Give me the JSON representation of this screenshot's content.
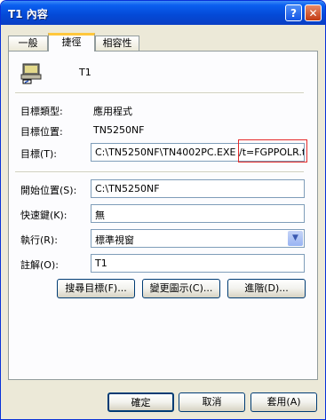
{
  "window": {
    "title": "T1 內容",
    "help_glyph": "?",
    "close_glyph": "✕"
  },
  "tabs": [
    {
      "label": "一般"
    },
    {
      "label": "捷徑",
      "active": true
    },
    {
      "label": "相容性"
    }
  ],
  "shortcut": {
    "name": "T1",
    "target_type_label": "目標類型:",
    "target_type_value": "應用程式",
    "target_location_label": "目標位置:",
    "target_location_value": "TN5250NF",
    "target_label": "目標(T):",
    "target_value_main": "C:\\TN5250NF\\TN4002PC.EXE /t=",
    "target_value_highlighted": "FGPPOLR.tto",
    "start_in_label": "開始位置(S):",
    "start_in_value": "C:\\TN5250NF",
    "shortcut_key_label": "快速鍵(K):",
    "shortcut_key_value": "無",
    "run_label": "執行(R):",
    "run_value": "標準視窗",
    "comment_label": "註解(O):",
    "comment_value": "T1"
  },
  "panel_buttons": {
    "find_target": "搜尋目標(F)...",
    "change_icon": "變更圖示(C)...",
    "advanced": "進階(D)..."
  },
  "dialog_buttons": {
    "ok": "確定",
    "cancel": "取消",
    "apply": "套用(A)"
  },
  "colors": {
    "titlebar": "#0a5ff0",
    "highlight_box": "#e52b2b",
    "dialog_bg": "#ece9d8"
  }
}
